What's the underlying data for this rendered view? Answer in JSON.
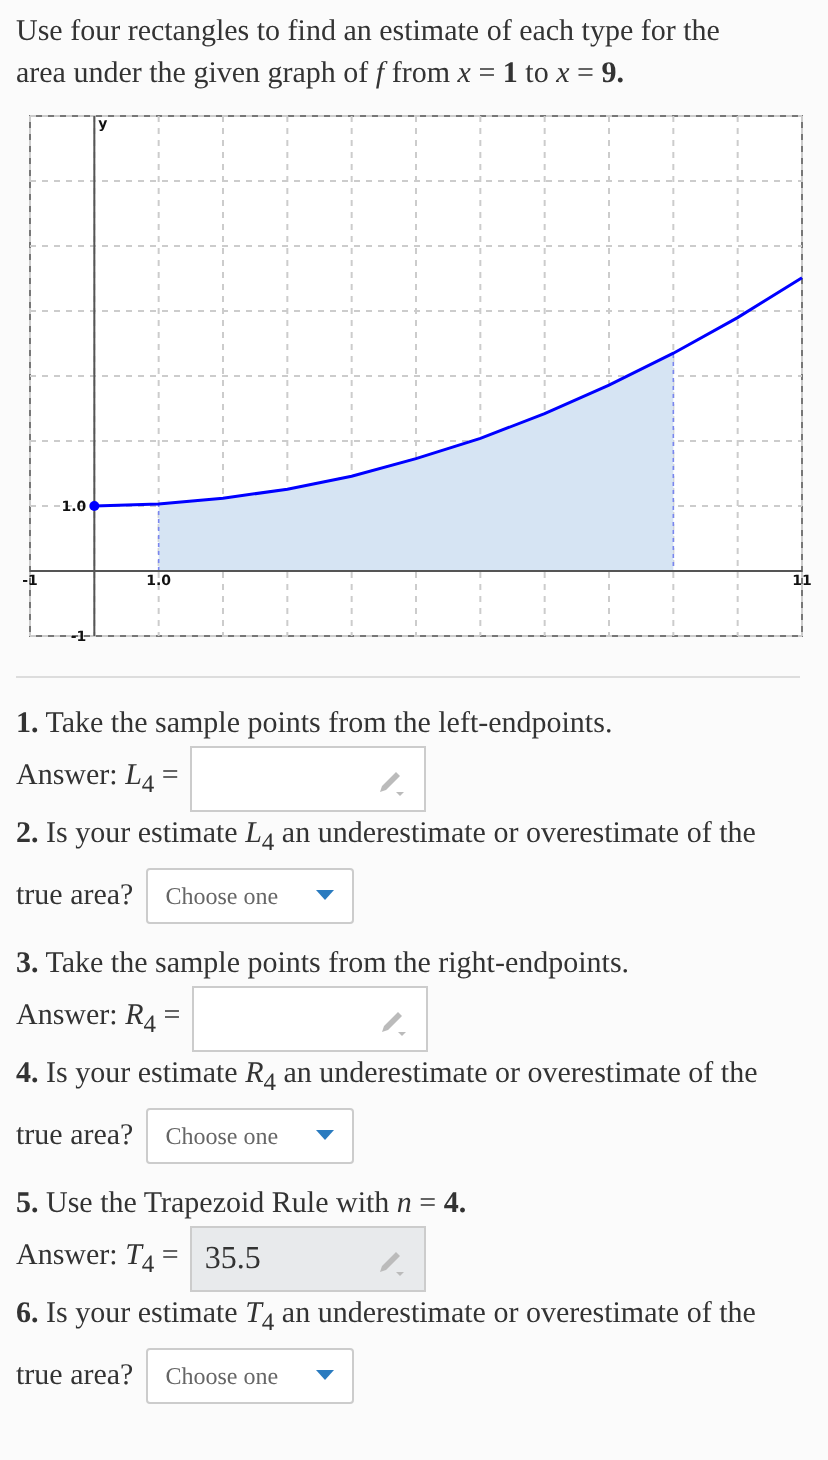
{
  "intro": "Use four rectangles to find an estimate of each type for the area under the given graph of *f* from *x* = **1** to *x* = **9.**",
  "graph": {
    "chart_data": {
      "type": "line",
      "ylabel": "y",
      "x": [
        0,
        1,
        2,
        3,
        4,
        5,
        6,
        7,
        8,
        9,
        10,
        11
      ],
      "series": [
        {
          "color": "#0000ff",
          "values": [
            1,
            1.03,
            1.12,
            1.26,
            1.46,
            1.73,
            2.04,
            2.42,
            2.86,
            3.35,
            3.9,
            4.51
          ]
        }
      ],
      "xlim": [
        -1,
        11
      ],
      "ylim": [
        -1,
        7
      ],
      "xticks": [
        -1,
        {
          "value": 1,
          "label": "1.0"
        },
        11
      ],
      "yticks": [
        -1,
        {
          "value": 1,
          "label": "1.0"
        }
      ]
    }
  },
  "questions": [
    {
      "kind": "input",
      "prompt": "**1.** Take the sample points from the left-endpoints.",
      "label": "Answer: *L*$_{4}$ ="
    },
    {
      "kind": "select",
      "prompt": "**2.** Is your estimate *L*$_{4}$ an underestimate or overestimate of the",
      "label": "true area?",
      "placeholder": "Choose one"
    },
    {
      "kind": "input",
      "prompt": "**3.** Take the sample points from the right-endpoints.",
      "label": "Answer: *R*$_{4}$ ="
    },
    {
      "kind": "select",
      "prompt": "**4.** Is your estimate *R*$_{4}$ an underestimate or overestimate of the",
      "label": "true area?",
      "placeholder": "Choose one"
    },
    {
      "kind": "input",
      "prompt": "**5.** Use the Trapezoid Rule with *n* = **4.**",
      "label": "Answer: *T*$_{4}$ =",
      "value": "35.5"
    },
    {
      "kind": "select",
      "prompt": "**6.** Is your estimate *T*$_{4}$ an underestimate or overestimate of the",
      "label": "true area?",
      "placeholder": "Choose one"
    }
  ]
}
